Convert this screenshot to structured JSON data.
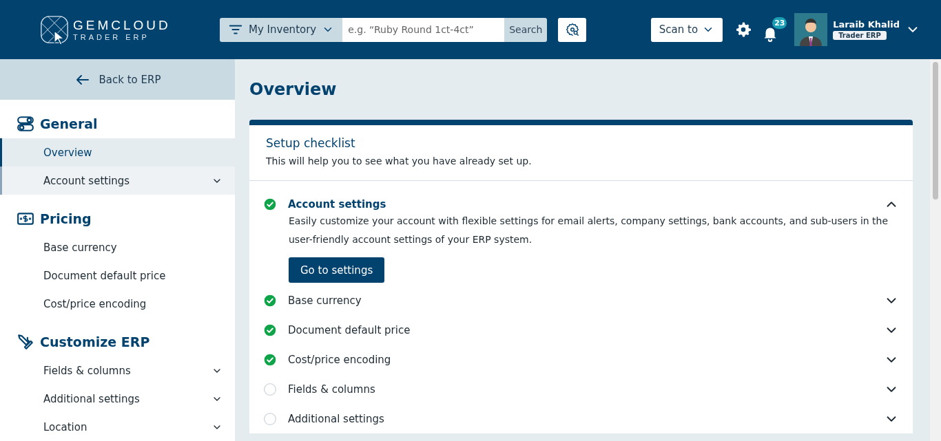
{
  "header": {
    "logo": {
      "name": "GEMCLOUD",
      "tagline": "TRADER ERP"
    },
    "search": {
      "scope": "My Inventory",
      "placeholder": "e.g. “Ruby Round 1ct-4ct”",
      "button": "Search"
    },
    "scan_button": "Scan to",
    "notifications": {
      "count": "23"
    },
    "user": {
      "name": "Laraib Khalid",
      "role": "Trader ERP"
    }
  },
  "sidebar": {
    "back": "Back to ERP",
    "sections": [
      {
        "title": "General",
        "items": [
          {
            "label": "Overview",
            "kind": "link",
            "selected": true,
            "highlighted": false
          },
          {
            "label": "Account settings",
            "kind": "dropdown",
            "selected": false,
            "highlighted": true
          }
        ]
      },
      {
        "title": "Pricing",
        "items": [
          {
            "label": "Base currency",
            "kind": "link",
            "selected": false,
            "highlighted": false
          },
          {
            "label": "Document default price",
            "kind": "link",
            "selected": false,
            "highlighted": false
          },
          {
            "label": "Cost/price encoding",
            "kind": "link",
            "selected": false,
            "highlighted": false
          }
        ]
      },
      {
        "title": "Customize ERP",
        "items": [
          {
            "label": "Fields & columns",
            "kind": "dropdown",
            "selected": false,
            "highlighted": false
          },
          {
            "label": "Additional settings",
            "kind": "dropdown",
            "selected": false,
            "highlighted": false
          },
          {
            "label": "Location",
            "kind": "dropdown",
            "selected": false,
            "highlighted": false
          }
        ]
      }
    ]
  },
  "main": {
    "title": "Overview",
    "checklist": {
      "title": "Setup checklist",
      "subtitle": "This will help you to see what you have already set up.",
      "items": [
        {
          "label": "Account settings",
          "done": true,
          "expanded": true,
          "description": "Easily customize your account with flexible settings for email alerts, company settings, bank accounts, and sub-users in the user-friendly account settings of your ERP system.",
          "button": "Go to settings"
        },
        {
          "label": "Base currency",
          "done": true,
          "expanded": false
        },
        {
          "label": "Document default price",
          "done": true,
          "expanded": false
        },
        {
          "label": "Cost/price encoding",
          "done": true,
          "expanded": false
        },
        {
          "label": "Fields & columns",
          "done": false,
          "expanded": false
        },
        {
          "label": "Additional settings",
          "done": false,
          "expanded": false
        }
      ]
    }
  }
}
